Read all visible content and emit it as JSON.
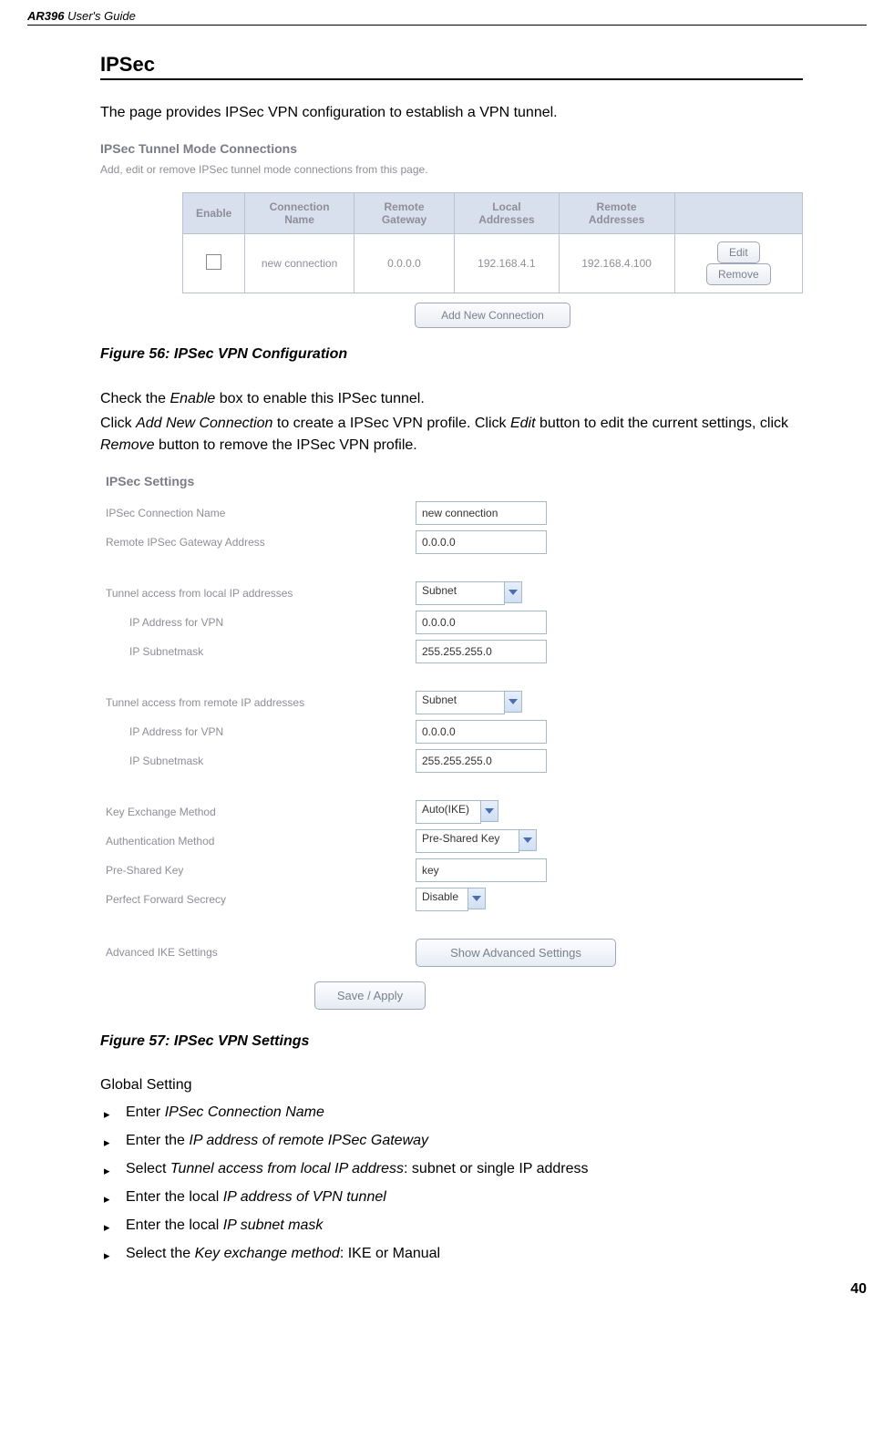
{
  "header": {
    "left_product": "AR396",
    "left_suffix": " User's Guide"
  },
  "section": {
    "title": "IPSec",
    "intro": "The page provides IPSec VPN configuration to establish a VPN tunnel."
  },
  "fig1": {
    "ss_title": "IPSec Tunnel Mode Connections",
    "ss_sub": "Add, edit or remove IPSec tunnel mode connections from this page.",
    "cols": {
      "enable": "Enable",
      "conn": "Connection Name",
      "gw": "Remote Gateway",
      "local": "Local Addresses",
      "remote": "Remote Addresses"
    },
    "row": {
      "conn": "new connection",
      "gw": "0.0.0.0",
      "local": "192.168.4.1",
      "remote": "192.168.4.100"
    },
    "btn_edit": "Edit",
    "btn_remove": "Remove",
    "btn_add": "Add New Connection",
    "caption": "Figure 56: IPSec VPN Configuration"
  },
  "midtext": {
    "l1a": "Check the ",
    "l1b": "Enable",
    "l1c": " box to enable this IPSec tunnel.",
    "l2a": "Click ",
    "l2b": "Add New Connection",
    "l2c": " to create a IPSec VPN profile. Click ",
    "l2d": "Edit",
    "l2e": " button to edit the current settings, click ",
    "l2f": "Remove",
    "l2g": " button to remove the IPSec VPN profile."
  },
  "fig2": {
    "ss_title": "IPSec Settings",
    "labels": {
      "conn_name": "IPSec Connection Name",
      "remote_gw": "Remote IPSec Gateway Address",
      "local_access": "Tunnel access from local IP addresses",
      "ip_vpn": "IP Address for VPN",
      "ip_mask": "IP Subnetmask",
      "remote_access": "Tunnel access from remote IP addresses",
      "kex": "Key Exchange Method",
      "auth": "Authentication Method",
      "psk": "Pre-Shared Key",
      "pfs": "Perfect Forward Secrecy",
      "adv": "Advanced IKE Settings"
    },
    "values": {
      "conn_name": "new connection",
      "remote_gw": "0.0.0.0",
      "local_sel": "Subnet",
      "local_ip": "0.0.0.0",
      "local_mask": "255.255.255.0",
      "remote_sel": "Subnet",
      "remote_ip": "0.0.0.0",
      "remote_mask": "255.255.255.0",
      "kex": "Auto(IKE)",
      "auth": "Pre-Shared Key",
      "psk": "key",
      "pfs": "Disable"
    },
    "btn_adv": "Show Advanced Settings",
    "btn_save": "Save / Apply",
    "caption": "Figure 57: IPSec VPN Settings"
  },
  "global": {
    "heading": "Global Setting",
    "items": [
      {
        "pre": "Enter ",
        "it": "IPSec Connection Name",
        "post": ""
      },
      {
        "pre": "Enter the ",
        "it": "IP address of remote IPSec Gateway",
        "post": ""
      },
      {
        "pre": "Select ",
        "it": "Tunnel access from local IP address",
        "post": ": subnet or single IP address"
      },
      {
        "pre": "Enter the local ",
        "it": "IP address of VPN tunnel",
        "post": ""
      },
      {
        "pre": "Enter the local ",
        "it": "IP subnet mask",
        "post": ""
      },
      {
        "pre": "Select the ",
        "it": "Key exchange method",
        "post": ": IKE or Manual"
      }
    ]
  },
  "page_number": "40"
}
